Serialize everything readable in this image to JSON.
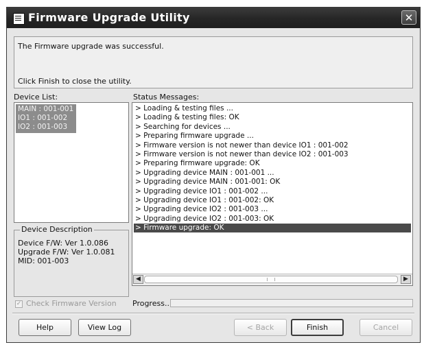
{
  "window": {
    "title": "Firmware Upgrade Utility",
    "close_symbol": "✕"
  },
  "message": {
    "line1": "The Firmware upgrade was successful.",
    "line2": "Click Finish to close the utility."
  },
  "device_list": {
    "label": "Device List:",
    "items": [
      "MAIN : 001-001",
      "IO1 : 001-002",
      "IO2 : 001-003"
    ]
  },
  "device_description": {
    "title": "Device Description",
    "device_fw": "Device F/W: Ver 1.0.086",
    "upgrade_fw": "Upgrade F/W: Ver 1.0.081",
    "mid": "MID: 001-003"
  },
  "status": {
    "label": "Status Messages:",
    "lines": [
      "> Loading & testing files ...",
      "> Loading & testing files: OK",
      "> Searching for devices ...",
      "> Preparing firmware upgrade ...",
      "> Firmware version is not newer than device IO1 : 001-002",
      "> Firmware version is not newer than device IO2 : 001-003",
      "> Preparing firmware upgrade: OK",
      "> Upgrading device MAIN : 001-001 ...",
      "> Upgrading device MAIN : 001-001: OK",
      "> Upgrading device IO1 : 001-002 ...",
      "> Upgrading device IO1 : 001-002: OK",
      "> Upgrading device IO2 : 001-003 ...",
      "> Upgrading device IO2 : 001-003: OK",
      "> Firmware upgrade: OK"
    ],
    "highlighted_index": 13
  },
  "options": {
    "check_firmware_label": "Check Firmware Version",
    "check_firmware_checked": true
  },
  "progress": {
    "label": "Progress...",
    "value": 0
  },
  "buttons": {
    "help": "Help",
    "view_log": "View Log",
    "back": "< Back",
    "finish": "Finish",
    "cancel": "Cancel"
  },
  "icons": {
    "app": "firmware-app-icon",
    "close": "close-icon",
    "scroll_left": "scroll-left-arrow-icon",
    "scroll_right": "scroll-right-arrow-icon"
  },
  "colors": {
    "titlebar": "#2b2b2b",
    "selection": "#8c8c8c",
    "highlight_row": "#4a4a4a"
  }
}
